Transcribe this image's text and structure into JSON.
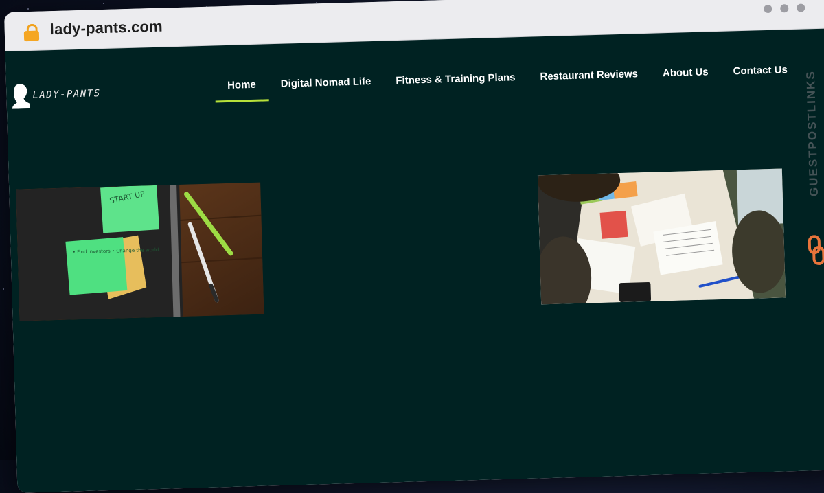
{
  "browser": {
    "url": "lady-pants.com",
    "lock_icon": "lock-icon"
  },
  "site": {
    "logo_text": "LADY-PANTS",
    "nav": [
      {
        "label": "Home",
        "active": true
      },
      {
        "label": "Digital Nomad Life",
        "active": false
      },
      {
        "label": "Fitness & Training Plans",
        "active": false
      },
      {
        "label": "Restaurant Reviews",
        "active": false
      },
      {
        "label": "About Us",
        "active": false
      },
      {
        "label": "Contact Us",
        "active": false
      }
    ],
    "sticky_notes": {
      "top": "START UP",
      "bottom": "• Find investors • Change the world"
    }
  },
  "watermark": {
    "text": "GUESTPOSTLINKS"
  },
  "colors": {
    "page_bg": "#002222",
    "nav_active_underline": "#b7e13a",
    "watermark_accent": "#e8743b"
  }
}
